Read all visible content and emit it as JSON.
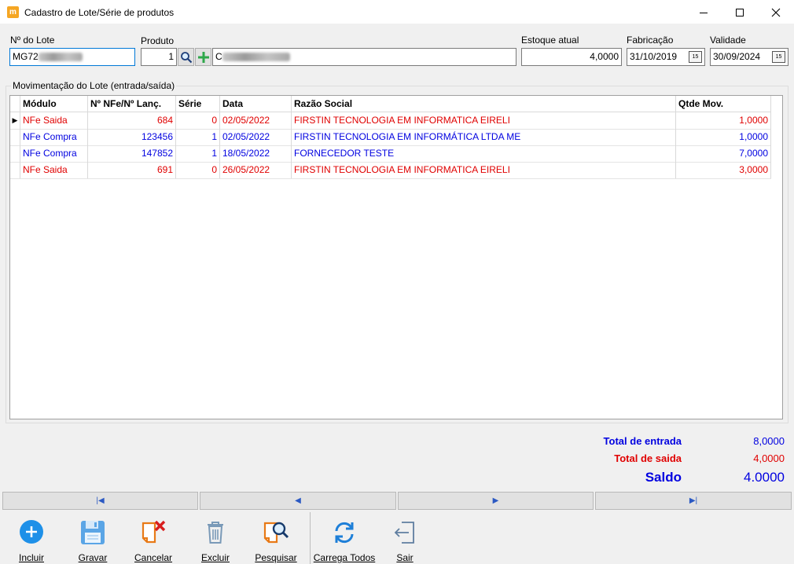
{
  "window": {
    "title": "Cadastro de Lote/Série de produtos",
    "app_icon_letter": "m"
  },
  "form": {
    "lote_label": "Nº do Lote",
    "lote_value": "MG72",
    "produto_label": "Produto",
    "produto_code": "1",
    "produto_name": "C",
    "estoque_label": "Estoque atual",
    "estoque_value": "4,0000",
    "fabricacao_label": "Fabricação",
    "fabricacao_value": "31/10/2019",
    "validade_label": "Validade",
    "validade_value": "30/09/2024",
    "calendar_glyph": "15"
  },
  "movimentacao": {
    "group_title": "Movimentação do Lote (entrada/saída)",
    "columns": [
      "Módulo",
      "Nº NFe/Nº Lanç.",
      "Série",
      "Data",
      "Razão Social",
      "Qtde Mov."
    ],
    "row_indicator": "▶",
    "rows": [
      {
        "modulo": "NFe Saida",
        "nfe": "684",
        "serie": "0",
        "data": "02/05/2022",
        "razao": "FIRSTIN TECNOLOGIA EM INFORMATICA EIRELI",
        "qtde": "1,0000",
        "color": "#e00000"
      },
      {
        "modulo": "NFe Compra",
        "nfe": "123456",
        "serie": "1",
        "data": "02/05/2022",
        "razao": "FIRSTIN TECNOLOGIA EM INFORMÁTICA LTDA ME",
        "qtde": "1,0000",
        "color": "#0000e0"
      },
      {
        "modulo": "NFe Compra",
        "nfe": "147852",
        "serie": "1",
        "data": "18/05/2022",
        "razao": "FORNECEDOR TESTE",
        "qtde": "7,0000",
        "color": "#0000e0"
      },
      {
        "modulo": "NFe Saida",
        "nfe": "691",
        "serie": "0",
        "data": "26/05/2022",
        "razao": "FIRSTIN TECNOLOGIA EM INFORMATICA EIRELI",
        "qtde": "3,0000",
        "color": "#e00000"
      }
    ]
  },
  "totals": {
    "entrada_label": "Total de entrada",
    "entrada_value": "8,0000",
    "saida_label": "Total de saida",
    "saida_value": "4,0000",
    "saldo_label": "Saldo",
    "saldo_value": "4.0000",
    "entrada_color": "#0000e0",
    "saida_color": "#e00000"
  },
  "navigation": {
    "first": "|◀",
    "prev": "◀",
    "next": "▶",
    "last": "▶|"
  },
  "toolbar": {
    "incluir": "Incluir",
    "gravar": "Gravar",
    "cancelar": "Cancelar",
    "excluir": "Excluir",
    "pesquisar": "Pesquisar",
    "carrega_todos": "Carrega Todos",
    "sair": "Sair"
  }
}
